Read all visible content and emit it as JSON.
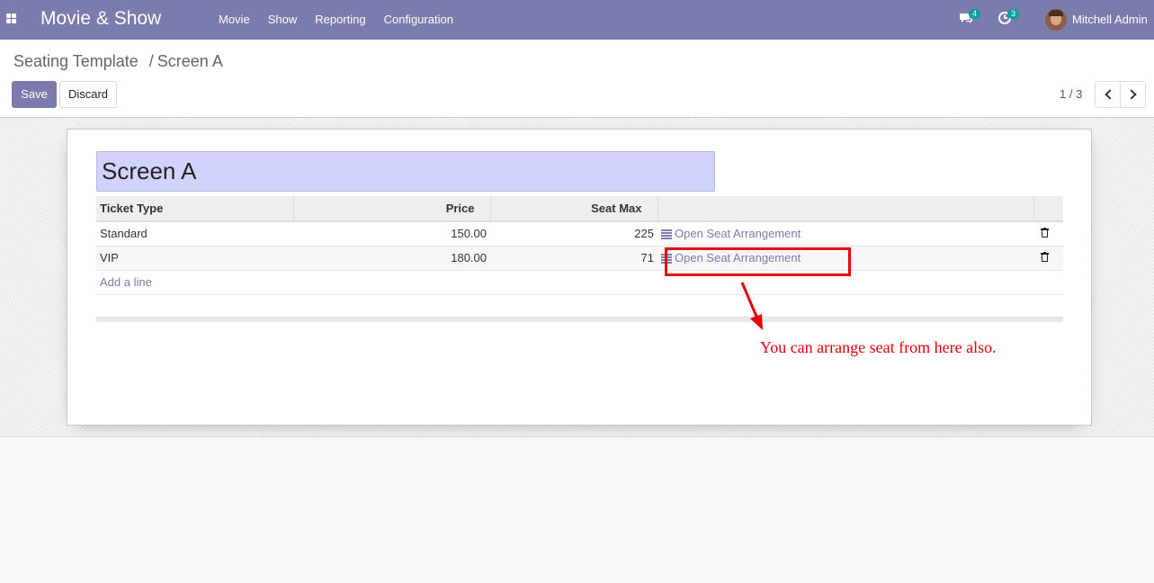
{
  "navbar": {
    "brand": "Movie & Show",
    "menu": [
      {
        "label": "Movie"
      },
      {
        "label": "Show"
      },
      {
        "label": "Reporting"
      },
      {
        "label": "Configuration"
      }
    ],
    "messages_count": "4",
    "activities_count": "3",
    "user_name": "Mitchell Admin"
  },
  "control_panel": {
    "breadcrumb_parent": "Seating Template",
    "breadcrumb_separator": "/",
    "breadcrumb_current": "Screen A",
    "save_label": "Save",
    "discard_label": "Discard",
    "pager_value": "1 / 3"
  },
  "form": {
    "name": "Screen A",
    "table": {
      "headers": [
        "Ticket Type",
        "Price",
        "Seat Max",
        ""
      ],
      "rows": [
        {
          "ticket_type": "Standard",
          "price": "150.00",
          "seat_max": "225",
          "action": "Open Seat Arrangement"
        },
        {
          "ticket_type": "VIP",
          "price": "180.00",
          "seat_max": "71",
          "action": "Open Seat Arrangement"
        }
      ],
      "add_line": "Add a line"
    }
  },
  "annotation": {
    "text": "You can arrange seat from here also.",
    "color": "#e6000a"
  },
  "colors": {
    "navbar": "#7c7bad",
    "primary_button": "#7c7bad",
    "name_field_bg": "#d2d2ff",
    "badge": "#00a09d"
  }
}
